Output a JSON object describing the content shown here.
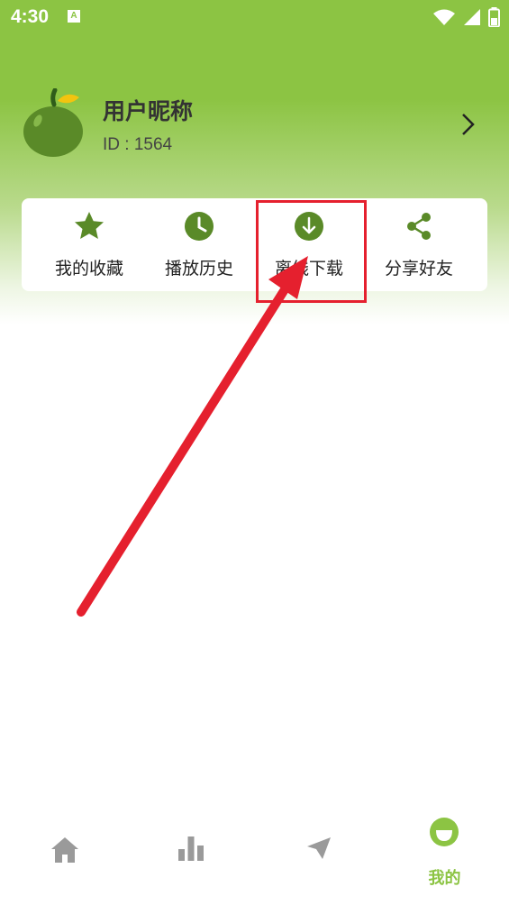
{
  "status_bar": {
    "time": "4:30",
    "notification_badge": "A",
    "icons": [
      "wifi-icon",
      "signal-icon",
      "battery-icon"
    ]
  },
  "profile": {
    "nickname": "用户昵称",
    "id_text": "ID : 1564",
    "avatar_icon": "green-apple-icon"
  },
  "menu": {
    "items": [
      {
        "label": "我的收藏",
        "icon": "star-icon"
      },
      {
        "label": "播放历史",
        "icon": "clock-icon"
      },
      {
        "label": "离线下载",
        "icon": "download-icon"
      },
      {
        "label": "分享好友",
        "icon": "share-icon"
      }
    ]
  },
  "bottom_nav": {
    "items": [
      {
        "icon": "home-icon",
        "label": ""
      },
      {
        "icon": "chart-icon",
        "label": ""
      },
      {
        "icon": "send-icon",
        "label": ""
      },
      {
        "icon": "smile-icon",
        "label": "我的",
        "active": true
      }
    ]
  },
  "colors": {
    "brand_green": "#8cc443",
    "icon_green": "#5a8a28",
    "annotation_red": "#e5202e"
  }
}
